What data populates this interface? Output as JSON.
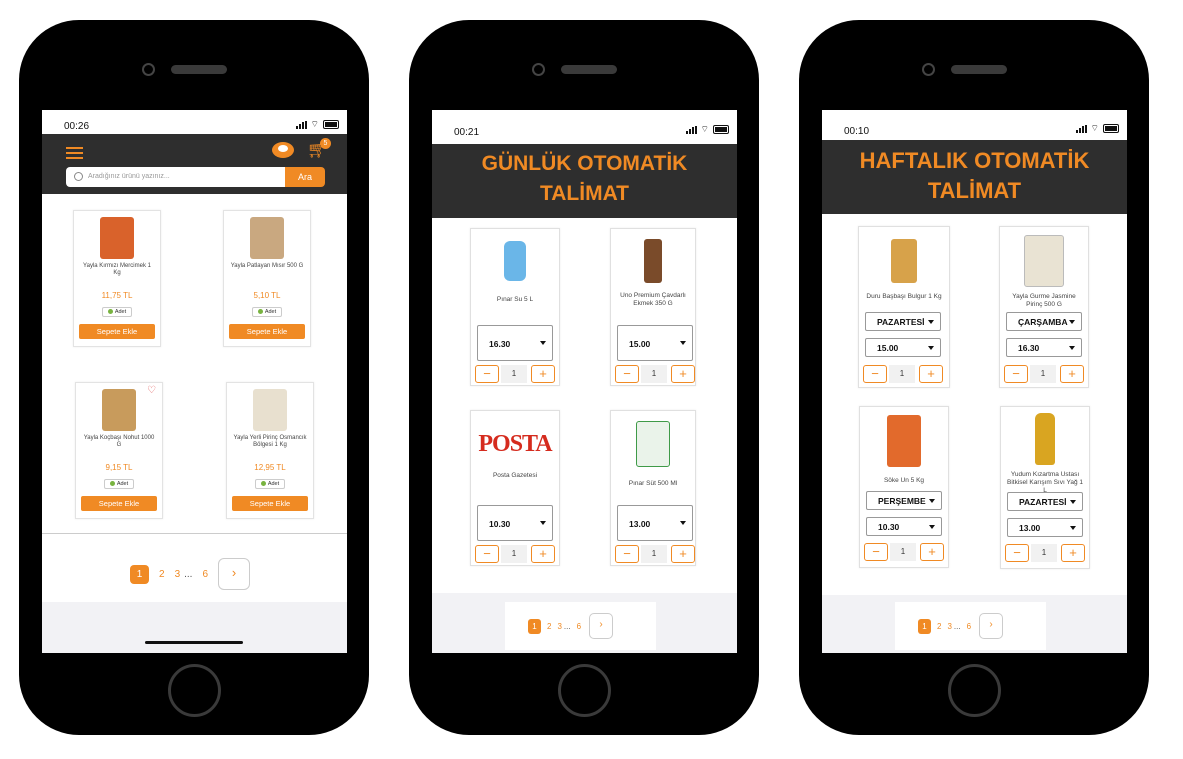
{
  "colors": {
    "accent": "#f08a24",
    "header_bg": "#2e2e2e",
    "footer_bg": "#f2f2f5"
  },
  "screen1": {
    "time": "00:26",
    "cart_count": "5",
    "search_placeholder": "Aradığınız ürünü yazınız...",
    "search_button": "Ara",
    "products": [
      {
        "name": "Yayla Kırmızı Mercimek 1 Kg",
        "price": "11,75 TL",
        "unit": "Adet",
        "button": "Sepete Ekle"
      },
      {
        "name": "Yayla Patlayan Mısır 500 G",
        "price": "5,10 TL",
        "unit": "Adet",
        "button": "Sepete Ekle"
      },
      {
        "name": "Yayla Koçbaşı Nohut 1000 G",
        "price": "9,15 TL",
        "unit": "Adet",
        "button": "Sepete Ekle"
      },
      {
        "name": "Yayla Yerli Pirinç Osmancık Bölgesi 1 Kg",
        "price": "12,95 TL",
        "unit": "Adet",
        "button": "Sepete Ekle"
      }
    ],
    "pagination": [
      "1",
      "2",
      "3",
      "...",
      "6",
      "›"
    ]
  },
  "screen2": {
    "time": "00:21",
    "title_line1": "GÜNLÜK OTOMATİK",
    "title_line2": "TALİMAT",
    "products": [
      {
        "name": "Pınar Su 5 L",
        "time": "16.30",
        "qty": "1"
      },
      {
        "name": "Uno Premium Çavdarlı Ekmek 350 G",
        "time": "15.00",
        "qty": "1"
      },
      {
        "name": "Posta Gazetesi",
        "logo": "POSTA",
        "time": "10.30",
        "qty": "1"
      },
      {
        "name": "Pınar Süt 500 Ml",
        "time": "13.00",
        "qty": "1"
      }
    ],
    "pagination": [
      "1",
      "2",
      "3",
      "...",
      "6",
      "›"
    ]
  },
  "screen3": {
    "time": "00:10",
    "title_line1": "HAFTALIK OTOMATİK",
    "title_line2": "TALİMAT",
    "products": [
      {
        "name": "Duru Başbaşı Bulgur 1 Kg",
        "day": "PAZARTESİ",
        "time": "15.00",
        "qty": "1"
      },
      {
        "name": "Yayla Gurme Jasmine Pirinç 500 G",
        "day": "ÇARŞAMBA",
        "time": "16.30",
        "qty": "1"
      },
      {
        "name": "Söke Un 5 Kg",
        "day": "PERŞEMBE",
        "time": "10.30",
        "qty": "1"
      },
      {
        "name": "Yudum Kızartma Ustası Bitkisel Karışım Sıvı Yağ 1 L",
        "day": "PAZARTESİ",
        "time": "13.00",
        "qty": "1"
      }
    ],
    "pagination": [
      "1",
      "2",
      "3",
      "...",
      "6",
      "›"
    ]
  }
}
